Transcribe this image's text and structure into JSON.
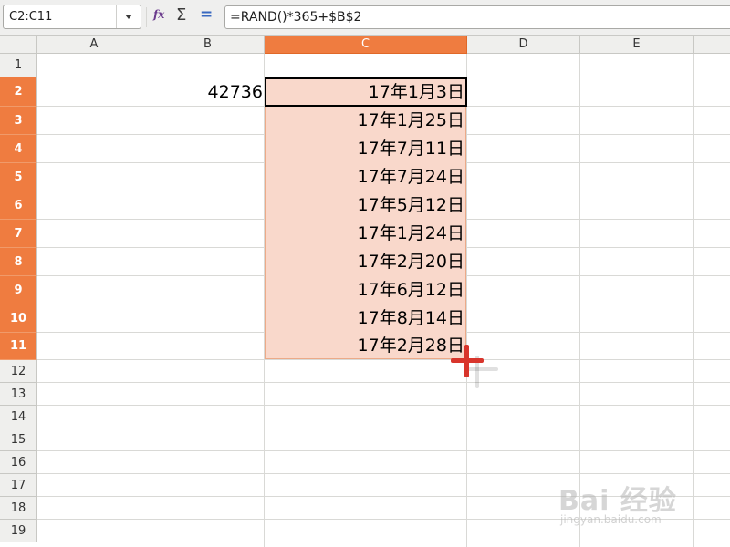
{
  "formula_bar": {
    "name_box": "C2:C11",
    "formula": "=RAND()*365+$B$2",
    "icons": [
      "function-wizard-icon",
      "sum-icon",
      "equals-icon"
    ]
  },
  "columns": [
    "A",
    "B",
    "C",
    "D",
    "E"
  ],
  "rows": [
    "1",
    "2",
    "3",
    "4",
    "5",
    "6",
    "7",
    "8",
    "9",
    "10",
    "11",
    "12",
    "13",
    "14",
    "15",
    "16",
    "17",
    "18",
    "19"
  ],
  "cells": {
    "B2": "42736",
    "C": [
      "17年1月3日",
      "17年1月25日",
      "17年7月11日",
      "17年7月24日",
      "17年5月12日",
      "17年1月24日",
      "17年2月20日",
      "17年6月12日",
      "17年8月14日",
      "17年2月28日"
    ]
  },
  "colors": {
    "selection_header": "#ef7c40",
    "selection_fill": "#f9d8cb",
    "cursor": "#d8352c"
  },
  "watermark": {
    "logo_text": "Bai 经验",
    "url": "jingyan.baidu.com"
  }
}
